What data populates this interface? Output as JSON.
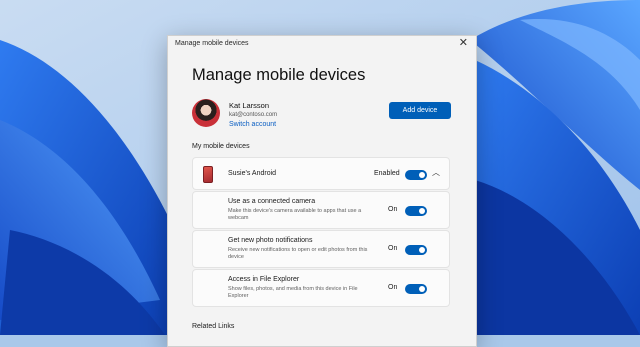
{
  "colors": {
    "accent": "#005fb8",
    "link": "#0a5ec2",
    "wallpaper_blue": "#1b5fd6"
  },
  "window": {
    "title": "Manage mobile devices",
    "close_icon": "close-icon"
  },
  "page": {
    "heading": "Manage mobile devices"
  },
  "account": {
    "name": "Kat Larsson",
    "email": "kat@contoso.com",
    "switch_label": "Switch account",
    "add_device_label": "Add device"
  },
  "devices_section": {
    "label": "My mobile devices"
  },
  "device": {
    "name": "Susie's Android",
    "status": "Enabled",
    "enabled": true,
    "icon": "phone-icon",
    "expanded": true
  },
  "settings": [
    {
      "name": "Use as a connected camera",
      "description": "Make this device's camera available to apps that use a webcam",
      "state": "On"
    },
    {
      "name": "Get new photo notifications",
      "description": "Receive new notifications to open or edit photos from this device",
      "state": "On"
    },
    {
      "name": "Access in File Explorer",
      "description": "Show files, photos, and media from this device in File Explorer",
      "state": "On"
    }
  ],
  "related": {
    "label": "Related Links"
  }
}
